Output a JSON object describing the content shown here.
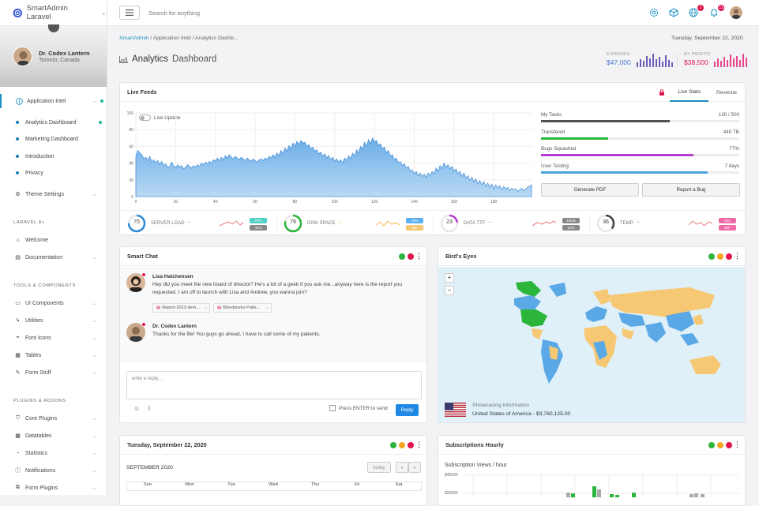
{
  "app": {
    "title": "SmartAdmin Laravel"
  },
  "profile": {
    "name": "Dr. Codex Lantern",
    "location": "Toronto, Canada"
  },
  "nav": {
    "application_intel": "Application Intel",
    "sub_items": [
      "Analytics Dashboard",
      "Marketing Dashboard",
      "Introduction",
      "Privacy"
    ],
    "theme_settings": "Theme Settings",
    "sec_laravel": "LARAVEL 8+",
    "welcome": "Welcome",
    "documentation": "Documentation",
    "sec_tools": "TOOLS & COMPONENTS",
    "ui_components": "UI Components",
    "utilities": "Utilities",
    "font_icons": "Font Icons",
    "tables": "Tables",
    "form_stuff": "Form Stuff",
    "sec_plugins": "PLUGINS & ADDONS",
    "core_plugins": "Core Plugins",
    "datatables": "Datatables",
    "statistics": "Statistics",
    "notifications": "Notifications",
    "form_plugins": "Form Plugins"
  },
  "topbar": {
    "search_placeholder": "Search for anything",
    "badge_globe": "1",
    "badge_bell": "11"
  },
  "breadcrumb": [
    "SmartAdmin",
    "Application Intel",
    "Analytics Dashb..."
  ],
  "date": "Tuesday, September 22, 2020",
  "page_title": {
    "main": "Analytics",
    "light": "Dashboard"
  },
  "stats": {
    "expenses_label": "EXPENSES",
    "expenses_value": "$47,000",
    "profits_label": "MY PROFITS",
    "profits_value": "$38,500"
  },
  "live_feeds": {
    "title": "Live Feeds",
    "tabs": [
      "Live Stats",
      "Revenue"
    ],
    "toggle_label": "Live Update",
    "bars": [
      {
        "label": "My Tasks",
        "value": "130 / 500",
        "fraction": 0.65,
        "color": "#505050"
      },
      {
        "label": "Transfered",
        "value": "440 TB",
        "fraction": 0.34,
        "color": "#2cb53b"
      },
      {
        "label": "Bugs Squashed",
        "value": "77%",
        "fraction": 0.77,
        "color": "#b53fd0"
      },
      {
        "label": "User Testing",
        "value": "7 days",
        "fraction": 0.84,
        "color": "#4aa3df"
      }
    ],
    "btn_pdf": "Generate PDF",
    "btn_bug": "Report a Bug",
    "gauges": [
      {
        "value": "75",
        "label": "SERVER LOAD",
        "color": "#2d8cd8",
        "pills": [
          "97%",
          "44%"
        ],
        "pill_colors": [
          "#4fd1c5",
          "#888"
        ]
      },
      {
        "value": "79",
        "label": "DISK SPACE",
        "color": "#2cb53b",
        "pills": [
          "76%",
          "3%"
        ],
        "pill_colors": [
          "#5ab0f0",
          "#f7c873"
        ]
      },
      {
        "value": "23",
        "label": "DATA TTF",
        "color": "#b53fd0",
        "pills": [
          "10GB",
          "10%"
        ],
        "pill_colors": [
          "#888",
          "#888"
        ]
      },
      {
        "value": "36",
        "label": "TEMP.",
        "color": "#444",
        "pills": [
          "124",
          "40F"
        ],
        "pill_colors": [
          "#f06aa8",
          "#f06aa8"
        ]
      }
    ]
  },
  "chart_data": {
    "type": "area",
    "x_ticks": [
      "0",
      "20",
      "40",
      "60",
      "80",
      "100",
      "120",
      "140",
      "160",
      "180"
    ],
    "y_ticks": [
      "0",
      "20",
      "40",
      "60",
      "80",
      "100"
    ],
    "ylim": [
      0,
      100
    ],
    "xlim": [
      0,
      199
    ],
    "y": [
      48,
      55,
      52,
      50,
      45,
      47,
      43,
      48,
      41,
      44,
      40,
      43,
      38,
      42,
      37,
      39,
      35,
      36,
      41,
      37,
      34,
      38,
      35,
      37,
      33,
      35,
      38,
      36,
      34,
      37,
      35,
      38,
      36,
      40,
      38,
      41,
      39,
      42,
      40,
      44,
      42,
      46,
      43,
      47,
      44,
      49,
      46,
      50,
      47,
      45,
      48,
      46,
      44,
      47,
      45,
      43,
      46,
      44,
      42,
      45,
      43,
      41,
      44,
      45,
      43,
      46,
      44,
      48,
      46,
      50,
      47,
      52,
      49,
      55,
      51,
      58,
      54,
      61,
      57,
      64,
      60,
      66,
      62,
      67,
      64,
      65,
      60,
      62,
      57,
      59,
      54,
      56,
      51,
      53,
      48,
      51,
      46,
      49,
      44,
      47,
      42,
      45,
      41,
      44,
      40,
      46,
      43,
      49,
      45,
      52,
      48,
      56,
      52,
      60,
      56,
      65,
      60,
      68,
      63,
      70,
      65,
      67,
      61,
      63,
      57,
      59,
      52,
      55,
      48,
      50,
      44,
      46,
      40,
      42,
      37,
      39,
      34,
      36,
      30,
      32,
      27,
      30,
      25,
      28,
      24,
      27,
      23,
      28,
      25,
      30,
      27,
      34,
      30,
      37,
      33,
      40,
      35,
      38,
      33,
      36,
      30,
      33,
      27,
      30,
      24,
      28,
      22,
      25,
      19,
      23,
      17,
      21,
      15,
      19,
      14,
      18,
      12,
      16,
      11,
      15,
      9,
      14,
      10,
      13,
      8,
      12,
      9,
      11,
      7,
      10,
      8,
      9,
      6,
      8,
      10,
      7,
      9,
      11,
      12,
      14
    ]
  },
  "chat": {
    "title": "Smart Chat",
    "messages": [
      {
        "name": "Lisa Hatchensen",
        "text1": "Hey did you meet the new board of director? He's a bit of a geek if you ask me...anyway here is the report you",
        "text2": "requested. I am off to launch with Lisa and Andrew, you wanna join?"
      },
      {
        "name": "Dr. Codex Lantern",
        "text1": "Thanks for the file! You guys go ahead, I have to call some of my patients.",
        "text2": ""
      }
    ],
    "attachments": [
      "Report-2013-dem...",
      "Bloodworks Patie..."
    ],
    "reply_placeholder": "write a reply...",
    "enter_label": "Press ENTER to send",
    "send": "Reply"
  },
  "map": {
    "title": "Bird's Eyes",
    "info_label": "Showcasing information",
    "info_value": "United States of America - $3,760,125.00",
    "zoom_in": "+",
    "zoom_out": "−"
  },
  "calendar": {
    "title": "Tuesday, September 22, 2020",
    "month": "SEPTEMBER 2020",
    "today": "today",
    "prev": "‹",
    "next": "›",
    "days": [
      "Sun",
      "Mon",
      "Tue",
      "Wed",
      "Thu",
      "Fri",
      "Sat"
    ]
  },
  "subs": {
    "title": "Subscriptions Hourly",
    "subtitle": "Subscription Views / hour",
    "ticks": [
      "$45000",
      "$25000"
    ]
  }
}
